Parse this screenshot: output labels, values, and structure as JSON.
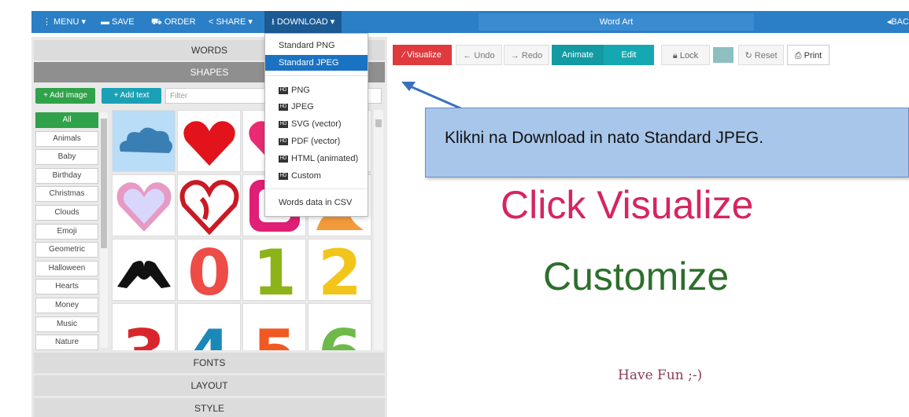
{
  "nav": {
    "menu": "MENU",
    "save": "SAVE",
    "order": "ORDER",
    "share": "SHARE",
    "download": "DOWNLOAD",
    "title": "Word Art",
    "right_label": "BAC"
  },
  "left": {
    "words": "WORDS",
    "shapes": "SHAPES",
    "add_image": "+ Add image",
    "add_text": "+ Add text",
    "filter_placeholder": "Filter",
    "categories": [
      "All",
      "Animals",
      "Baby",
      "Birthday",
      "Christmas",
      "Clouds",
      "Emoji",
      "Geometric",
      "Halloween",
      "Hearts",
      "Money",
      "Music",
      "Nature"
    ],
    "fonts": "FONTS",
    "layout": "LAYOUT",
    "style": "STYLE"
  },
  "download_menu": {
    "standard_png": "Standard PNG",
    "standard_jpeg": "Standard JPEG",
    "hd_badge": "HD",
    "png": "PNG",
    "jpeg": "JPEG",
    "svg": "SVG (vector)",
    "pdf": "PDF (vector)",
    "html": "HTML (animated)",
    "custom": "Custom",
    "words_csv": "Words data in CSV"
  },
  "toolbar": {
    "visualize": "Visualize",
    "undo": "Undo",
    "redo": "Redo",
    "animate": "Animate",
    "edit": "Edit",
    "lock": "Lock",
    "reset": "Reset",
    "print": "Print",
    "swatch_color": "#8ebfc1"
  },
  "canvas": {
    "line1": "Click Visualize",
    "line2": "Customize",
    "line3": "Have Fun ;-)"
  },
  "callout": {
    "text": "Klikni na Download in nato  Standard JPEG."
  },
  "colors": {
    "nav_blue": "#2a7fc7",
    "accent_red": "#e0393e",
    "accent_teal": "#139aa3",
    "accent_green": "#2fa24a",
    "callout_fill": "#a7c6ea"
  },
  "shapes": [
    "cloud",
    "heart",
    "heart",
    "heart-outline",
    "heart-ribbon",
    "heart-square",
    "hands-heart",
    "digit-0",
    "digit-1",
    "digit-2",
    "digit-3",
    "digit-4",
    "digit-5",
    "digit-6"
  ],
  "digits": [
    "0",
    "1",
    "2",
    "3",
    "4",
    "5",
    "6"
  ]
}
